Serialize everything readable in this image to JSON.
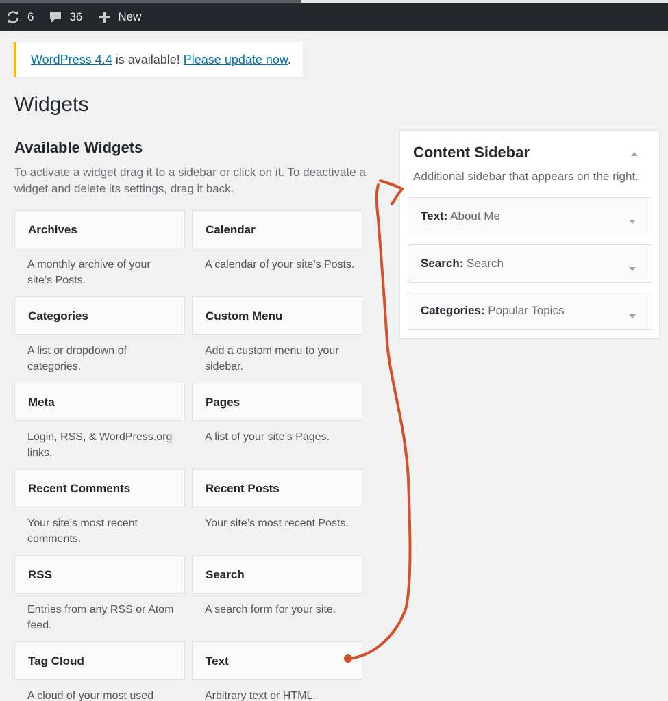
{
  "adminbar": {
    "updates_count": "6",
    "comments_count": "36",
    "new_label": "New"
  },
  "notice": {
    "version_link": "WordPress 4.4",
    "middle_text": " is available! ",
    "update_link": "Please update now",
    "end_text": "."
  },
  "page_title": "Widgets",
  "available": {
    "title": "Available Widgets",
    "description": "To activate a widget drag it to a sidebar or click on it. To deactivate a widget and delete its settings, drag it back."
  },
  "widgets": [
    {
      "name": "Archives",
      "desc": "A monthly archive of your site’s Posts."
    },
    {
      "name": "Calendar",
      "desc": "A calendar of your site’s Posts."
    },
    {
      "name": "Categories",
      "desc": "A list or dropdown of categories."
    },
    {
      "name": "Custom Menu",
      "desc": "Add a custom menu to your sidebar."
    },
    {
      "name": "Meta",
      "desc": "Login, RSS, & WordPress.org links."
    },
    {
      "name": "Pages",
      "desc": "A list of your site’s Pages."
    },
    {
      "name": "Recent Comments",
      "desc": "Your site’s most recent comments."
    },
    {
      "name": "Recent Posts",
      "desc": "Your site’s most recent Posts."
    },
    {
      "name": "RSS",
      "desc": "Entries from any RSS or Atom feed."
    },
    {
      "name": "Search",
      "desc": "A search form for your site."
    },
    {
      "name": "Tag Cloud",
      "desc": "A cloud of your most used"
    },
    {
      "name": "Text",
      "desc": "Arbitrary text or HTML."
    }
  ],
  "sidebar": {
    "title": "Content Sidebar",
    "description": "Additional sidebar that appears on the right.",
    "widgets": [
      {
        "type": "Text:",
        "title": " About Me"
      },
      {
        "type": "Search:",
        "title": " Search"
      },
      {
        "type": "Categories:",
        "title": " Popular Topics"
      }
    ]
  },
  "colors": {
    "adminbar_bg": "#23282d",
    "notice_border": "#ffba00",
    "link": "#0073aa",
    "annotation_arrow": "#d5502a"
  }
}
